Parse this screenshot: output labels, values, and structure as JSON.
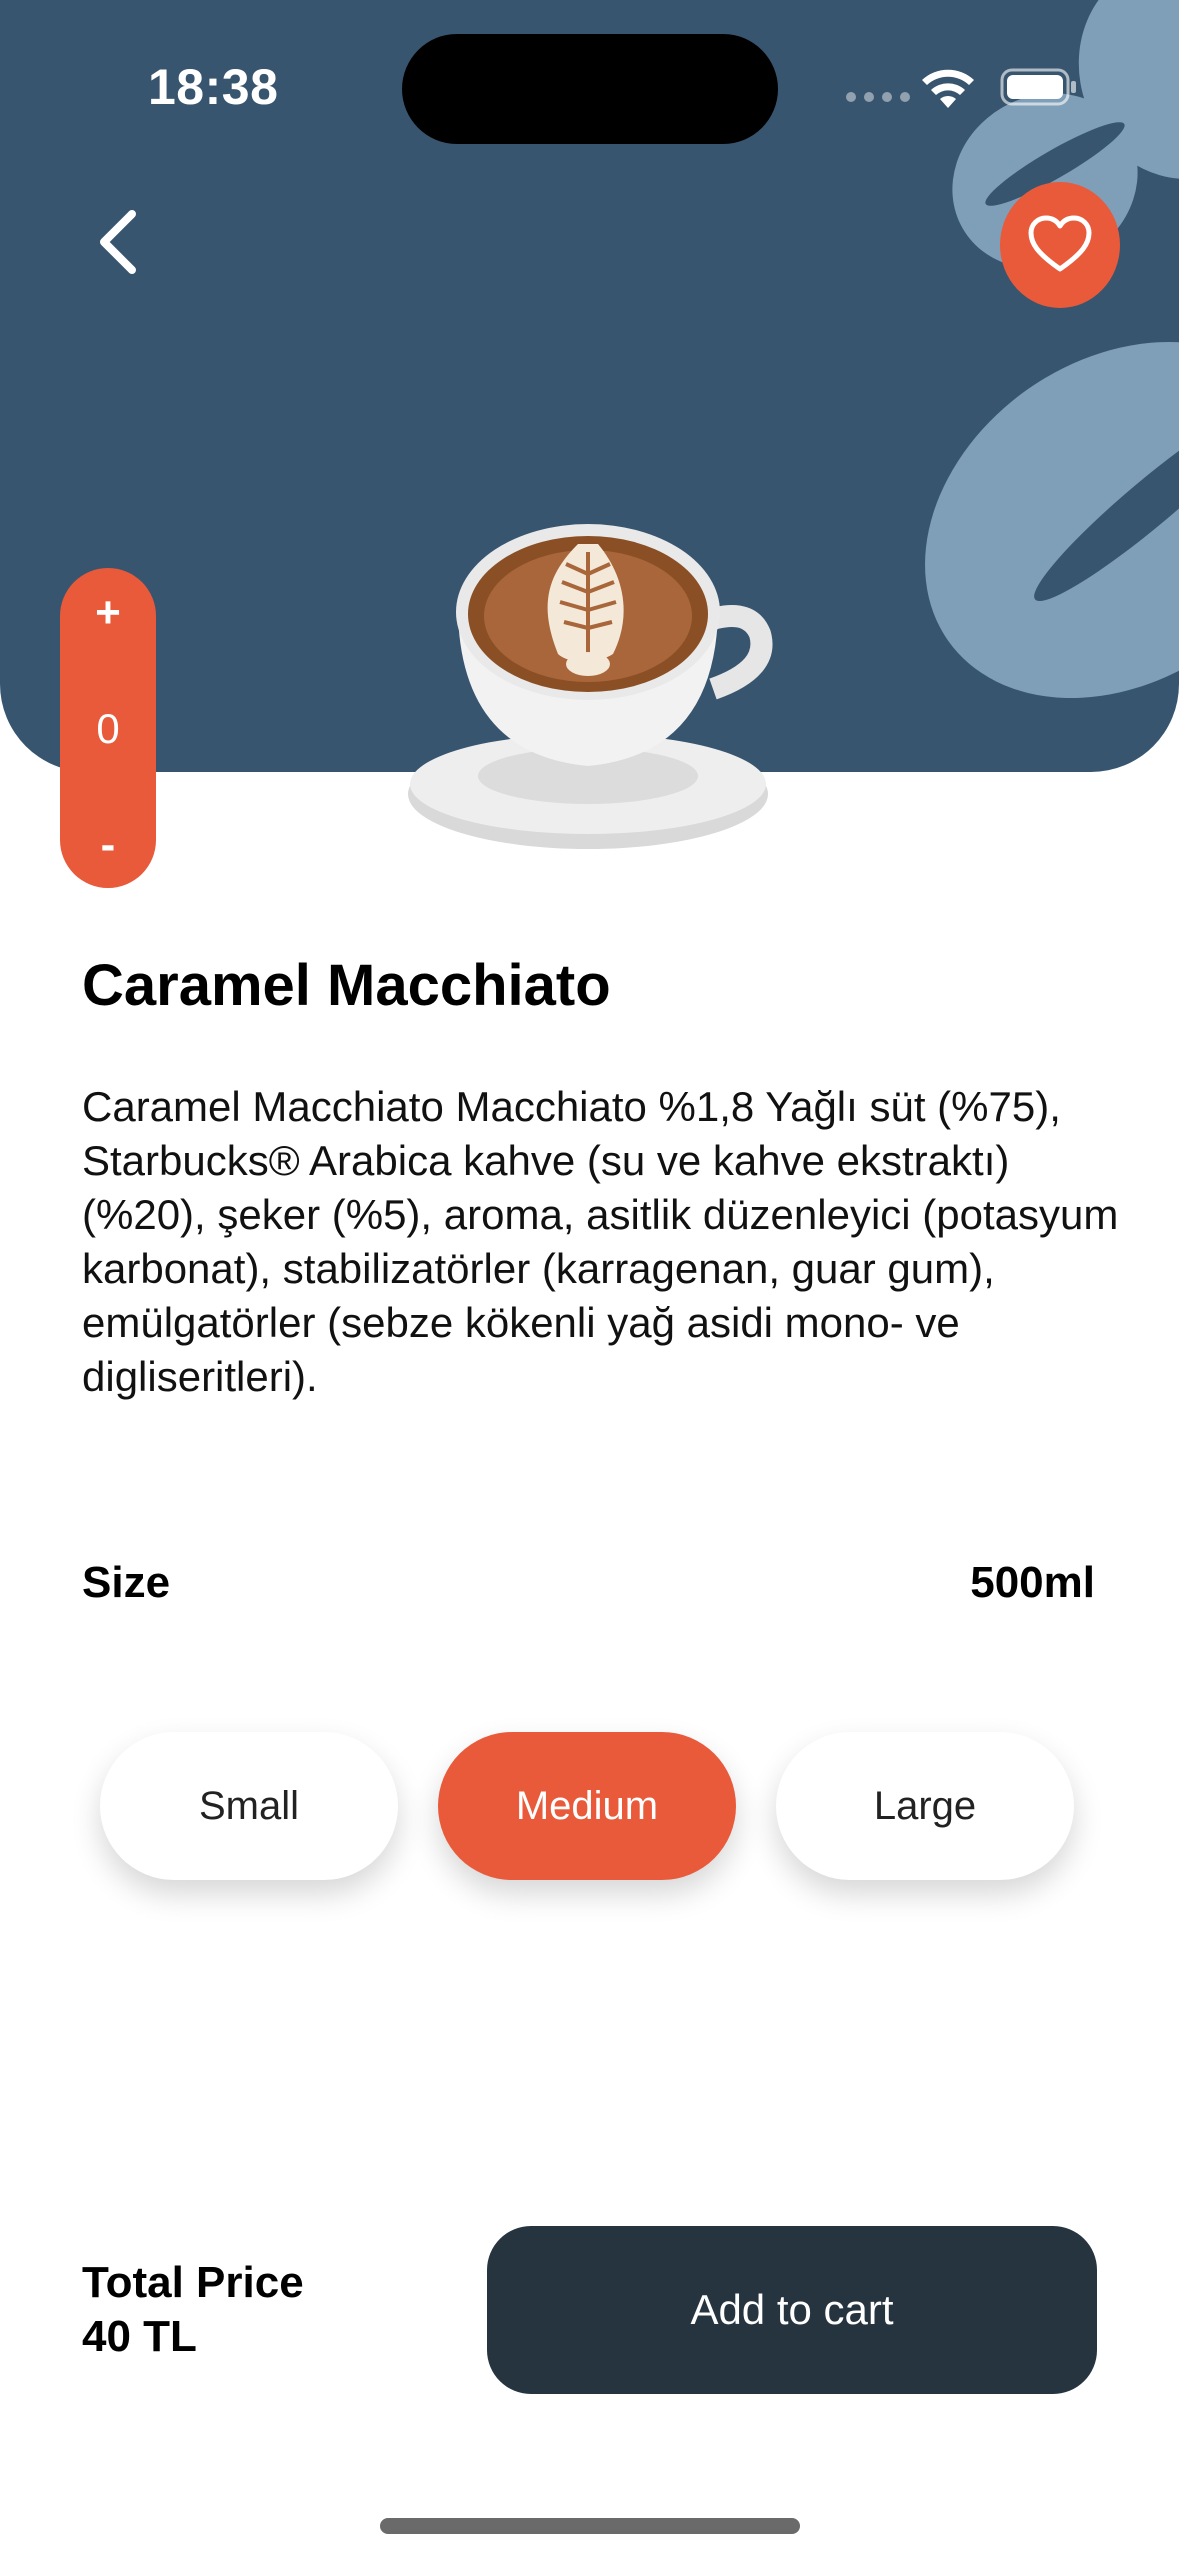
{
  "status_bar": {
    "time": "18:38"
  },
  "header": {
    "back_icon": "chevron-left-icon",
    "favorite_icon": "heart-icon"
  },
  "stepper": {
    "plus": "+",
    "count": "0",
    "minus": "-"
  },
  "product": {
    "name": "Caramel Macchiato",
    "description": "Caramel Macchiato Macchiato %1,8 Yağlı süt (%75), Starbucks® Arabica kahve (su ve kahve ekstraktı) (%20), şeker (%5), aroma, asitlik düzenleyici (potasyum karbonat), stabilizatörler (karragenan, guar gum), emülgatörler (sebze kökenli yağ asidi mono- ve digliseritleri)."
  },
  "size": {
    "label": "Size",
    "value": "500ml",
    "options": [
      "Small",
      "Medium",
      "Large"
    ],
    "selected": "Medium"
  },
  "footer": {
    "total_label": "Total Price",
    "total_value": "40 TL",
    "cart_button": "Add to cart"
  },
  "colors": {
    "header_bg": "#38556f",
    "accent": "#e85a3a",
    "button_dark": "#263440",
    "bean": "#7f9eb7"
  }
}
